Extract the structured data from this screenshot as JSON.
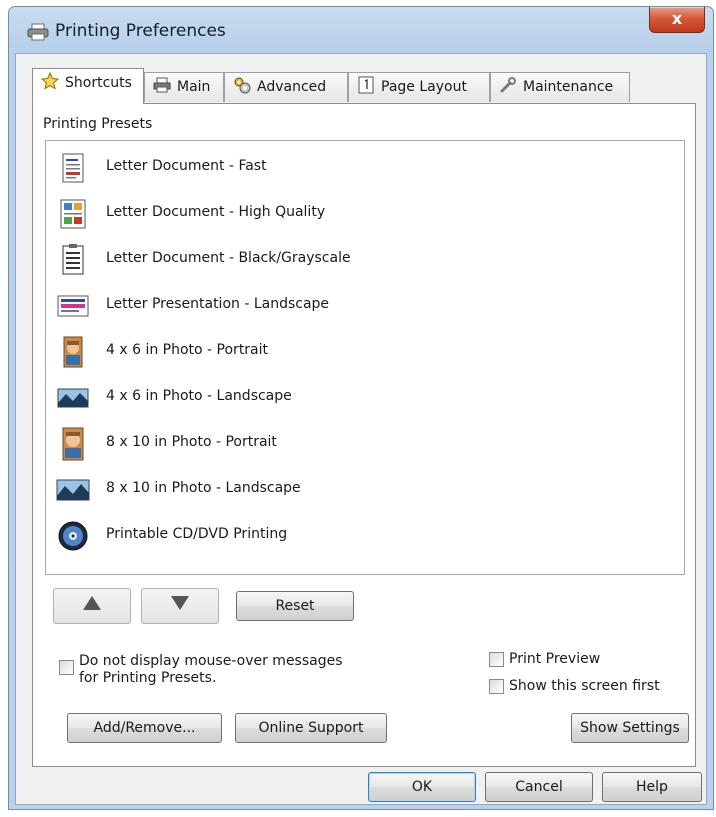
{
  "window": {
    "title": "Printing Preferences",
    "close_glyph": "x"
  },
  "tabs": [
    {
      "label": "Shortcuts",
      "icon": "star-icon",
      "active": true
    },
    {
      "label": "Main",
      "icon": "printer-icon",
      "active": false
    },
    {
      "label": "Advanced",
      "icon": "gears-icon",
      "active": false
    },
    {
      "label": "Page Layout",
      "icon": "page-icon",
      "active": false
    },
    {
      "label": "Maintenance",
      "icon": "wrench-icon",
      "active": false
    }
  ],
  "presets": {
    "group_label": "Printing Presets",
    "items": [
      {
        "label": "Letter Document - Fast",
        "icon": "document-fast-icon"
      },
      {
        "label": "Letter Document - High Quality",
        "icon": "document-high-quality-icon"
      },
      {
        "label": "Letter Document - Black/Grayscale",
        "icon": "document-grayscale-icon"
      },
      {
        "label": "Letter Presentation - Landscape",
        "icon": "presentation-landscape-icon"
      },
      {
        "label": "4 x 6 in Photo - Portrait",
        "icon": "photo-portrait-icon"
      },
      {
        "label": "4 x 6 in Photo - Landscape",
        "icon": "photo-landscape-icon"
      },
      {
        "label": "8 x 10 in Photo - Portrait",
        "icon": "photo-portrait-icon"
      },
      {
        "label": "8 x 10 in Photo - Landscape",
        "icon": "photo-landscape-icon"
      },
      {
        "label": "Printable CD/DVD Printing",
        "icon": "cd-dvd-icon"
      }
    ]
  },
  "controls": {
    "up_icon": "up-arrow-icon",
    "down_icon": "down-arrow-icon",
    "reset_label": "Reset",
    "mouseover_line1": "Do not display mouse-over messages",
    "mouseover_line2": "for Printing Presets.",
    "print_preview_label": "Print Preview",
    "show_first_label": "Show this screen first",
    "add_remove_label": "Add/Remove...",
    "online_support_label": "Online Support",
    "show_settings_label": "Show Settings"
  },
  "footer": {
    "ok_label": "OK",
    "cancel_label": "Cancel",
    "help_label": "Help"
  }
}
